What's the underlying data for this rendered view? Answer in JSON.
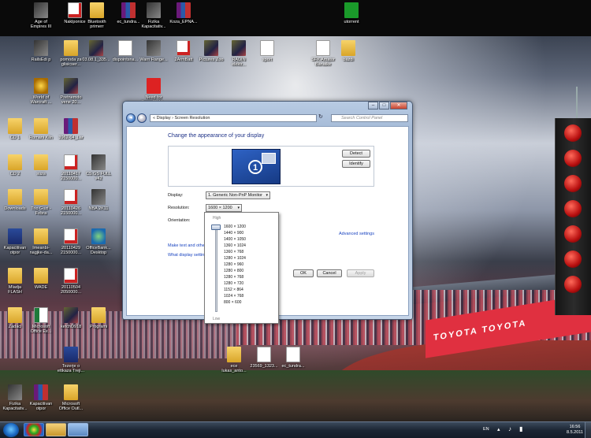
{
  "desktop_icons": [
    {
      "label": "Age of\nEmpires III",
      "glyph": "app-icon",
      "kind": "g-app"
    },
    {
      "label": "Naklponice",
      "glyph": "pdf-icon",
      "kind": "g-pdf"
    },
    {
      "label": "Bluetooth\nprimerr",
      "glyph": "folder-icon",
      "kind": "g-folder"
    },
    {
      "label": "ec_tundra...",
      "glyph": "rar-icon",
      "kind": "g-rar"
    },
    {
      "label": "Fizika\nKapacitativ...",
      "glyph": "app-icon",
      "kind": "g-app"
    },
    {
      "label": "Koza_EPNA...",
      "glyph": "rar-icon",
      "kind": "g-rar"
    },
    {
      "label": "utorrent",
      "glyph": "utorrent-icon",
      "kind": "g-green"
    },
    {
      "label": "RailsEdi p",
      "glyph": "app-icon",
      "kind": "g-app"
    },
    {
      "label": "pomoda za\nglisicser...",
      "glyph": "folder-icon",
      "kind": "g-folder"
    },
    {
      "label": "03.08.1_335...",
      "glyph": "image-icon",
      "kind": "g-img"
    },
    {
      "label": "dispointsna...",
      "glyph": "document-icon",
      "kind": "g-doc"
    },
    {
      "label": "Warn Range...",
      "glyph": "app-icon",
      "kind": "g-app"
    },
    {
      "label": "2ArmBatt",
      "glyph": "pdf-icon",
      "kind": "g-pdf"
    },
    {
      "label": "Pictures Zoo",
      "glyph": "image-icon",
      "kind": "g-img"
    },
    {
      "label": "RADIN\nelektr...",
      "glyph": "image-icon",
      "kind": "g-img"
    },
    {
      "label": "sport",
      "glyph": "document-icon",
      "kind": "g-doc"
    },
    {
      "label": "SFK Amator\nBanatke",
      "glyph": "document-icon",
      "kind": "g-doc"
    },
    {
      "label": "bazdi",
      "glyph": "folder-icon",
      "kind": "g-folder"
    },
    {
      "label": "World of\nWarcraft ...",
      "glyph": "wow-icon",
      "kind": "g-wow"
    },
    {
      "label": "Pretnemdo\nvene 20...",
      "glyph": "image-icon",
      "kind": "g-img"
    },
    {
      "label": "Need for\nSpeed™ U...",
      "glyph": "app-icon",
      "kind": "g-ff"
    },
    {
      "label": "CD 1",
      "glyph": "folder-icon",
      "kind": "g-folder"
    },
    {
      "label": "Romani Kiln",
      "glyph": "folder-icon",
      "kind": "g-folder"
    },
    {
      "label": "3962-04_Lar",
      "glyph": "rar-icon",
      "kind": "g-rar"
    },
    {
      "label": "CD 2",
      "glyph": "folder-icon",
      "kind": "g-folder"
    },
    {
      "label": "suza",
      "glyph": "folder-icon",
      "kind": "g-folder"
    },
    {
      "label": "20110417\n2150000...",
      "glyph": "pdf-icon",
      "kind": "g-pdf"
    },
    {
      "label": "CS:GS FULL\nv42",
      "glyph": "app-icon",
      "kind": "g-app"
    },
    {
      "label": "Downloads",
      "glyph": "folder-icon",
      "kind": "g-folder"
    },
    {
      "label": "Trio Guzi -\nFebra",
      "glyph": "folder-icon",
      "kind": "g-folder"
    },
    {
      "label": "20110426\n2150000...",
      "glyph": "pdf-icon",
      "kind": "g-pdf"
    },
    {
      "label": "NBA 2K11",
      "glyph": "app-icon",
      "kind": "g-app"
    },
    {
      "label": "Kapacitivan\notpor",
      "glyph": "document-icon",
      "kind": "g-blue"
    },
    {
      "label": "Imeanbi-\nnagjke-da...",
      "glyph": "folder-icon",
      "kind": "g-folder"
    },
    {
      "label": "20110429\n2150000...",
      "glyph": "pdf-icon",
      "kind": "g-pdf"
    },
    {
      "label": "OfficeBank...\nDesktop",
      "glyph": "globe-icon",
      "kind": "g-globe"
    },
    {
      "label": "Mladja\nFLASH",
      "glyph": "folder-icon",
      "kind": "g-folder"
    },
    {
      "label": "WADE",
      "glyph": "folder-icon",
      "kind": "g-folder"
    },
    {
      "label": "20110504\n2050000...",
      "glyph": "pdf-icon",
      "kind": "g-pdf"
    },
    {
      "label": "Zadaci",
      "glyph": "folder-icon",
      "kind": "g-folder"
    },
    {
      "label": "Microsoft\nOffice Ex...",
      "glyph": "excel-icon",
      "kind": "g-xls"
    },
    {
      "label": "ketchD918",
      "glyph": "image-icon",
      "kind": "g-img"
    },
    {
      "label": "Programi",
      "glyph": "folder-icon",
      "kind": "g-folder"
    },
    {
      "label": "Tezerje o\nettkaza Treji...",
      "glyph": "document-icon",
      "kind": "g-blue"
    },
    {
      "label": "ece\nlukas_anto...",
      "glyph": "folder-icon",
      "kind": "g-folder"
    },
    {
      "label": "23569_1323...",
      "glyph": "document-icon",
      "kind": "g-doc"
    },
    {
      "label": "ec_tundra...",
      "glyph": "document-icon",
      "kind": "g-doc"
    },
    {
      "label": "Fizika\nKapacitativ...",
      "glyph": "app-icon",
      "kind": "g-app"
    },
    {
      "label": "Kapacitivan\notpor",
      "glyph": "rar-icon",
      "kind": "g-rar"
    },
    {
      "label": "Microsoft\nOffice Outl...",
      "glyph": "outlook-icon",
      "kind": "g-folder"
    }
  ],
  "stadium": {
    "banner_text": "TOYOTA TOYOTA"
  },
  "window": {
    "breadcrumb": "«  Display  ›  Screen Resolution",
    "search_placeholder": "Search Control Panel",
    "heading": "Change the appearance of your display",
    "monitor_number": "1",
    "detect_label": "Detect",
    "identify_label": "Identify",
    "display_label": "Display:",
    "display_value": "1. Generic Non-PnP Monitor",
    "resolution_label": "Resolution:",
    "resolution_value": "1600 × 1200",
    "orientation_label": "Orientation:",
    "advanced_link": "Advanced settings",
    "link_text_other": "Make text and other",
    "link_display_settings": "What display settin",
    "ok_label": "OK",
    "cancel_label": "Cancel",
    "apply_label": "Apply",
    "dropdown": {
      "high_label": "High",
      "low_label": "Low",
      "options": [
        "1600 × 1200",
        "1440 × 900",
        "1400 × 1050",
        "1360 × 1024",
        "1360 × 768",
        "1280 × 1024",
        "1280 × 960",
        "1280 × 800",
        "1280 × 768",
        "1280 × 720",
        "1152 × 864",
        "1024 × 768",
        "800 × 600"
      ]
    }
  },
  "taskbar": {
    "language": "EN",
    "time": "16:56",
    "date": "8.5.2011"
  }
}
